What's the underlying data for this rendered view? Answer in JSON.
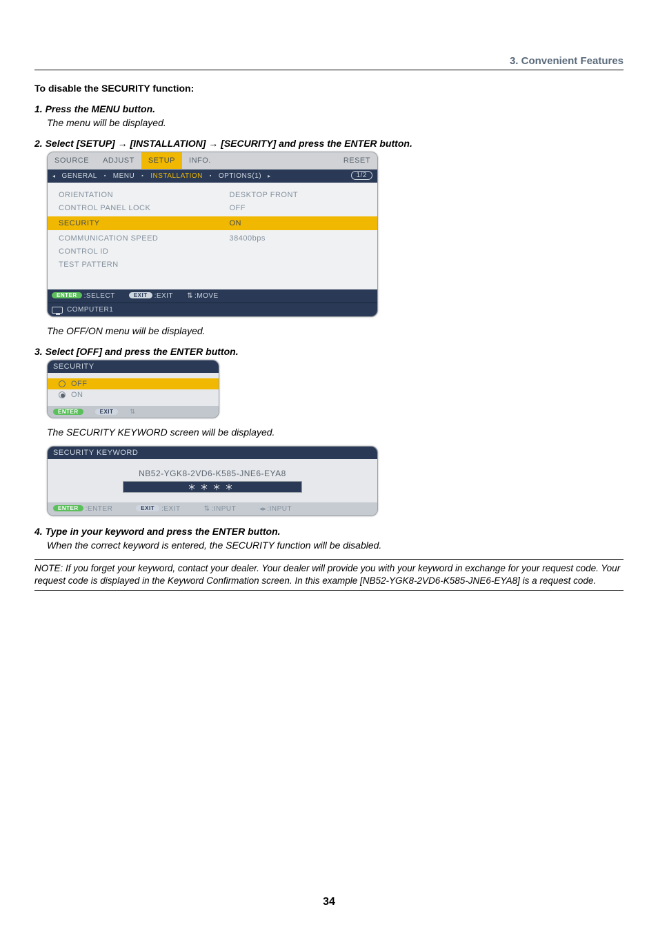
{
  "section": {
    "chapter": "3.  Convenient Features"
  },
  "headings": {
    "disable_title": "To disable the SECURITY function:"
  },
  "steps": {
    "s1": {
      "title": "1.  Press the MENU button.",
      "desc": "The menu will be displayed."
    },
    "s2": {
      "title": "2.  Select [SETUP] → [INSTALLATION] → [SECURITY] and press the ENTER button.",
      "desc_after": "The OFF/ON menu will be displayed."
    },
    "s3": {
      "title": "3.  Select [OFF] and press the ENTER button.",
      "desc_after": "The SECURITY KEYWORD screen will be displayed."
    },
    "s4": {
      "title": "4.  Type in your keyword and press the ENTER button.",
      "desc_after": "When the correct keyword is entered, the SECURITY function will be disabled."
    }
  },
  "menu1": {
    "tabs": {
      "source": "SOURCE",
      "adjust": "ADJUST",
      "setup": "SETUP",
      "info": "INFO.",
      "reset": "RESET"
    },
    "subtabs": {
      "general": "GENERAL",
      "menu": "MENU",
      "installation": "INSTALLATION",
      "options1": "OPTIONS(1)"
    },
    "page_badge": "1/2",
    "rows": {
      "orientation": {
        "label": "ORIENTATION",
        "value": "DESKTOP FRONT"
      },
      "cp_lock": {
        "label": "CONTROL PANEL LOCK",
        "value": "OFF"
      },
      "security": {
        "label": "SECURITY",
        "value": "ON"
      },
      "comm_speed": {
        "label": "COMMUNICATION SPEED",
        "value": "38400bps"
      },
      "control_id": {
        "label": "CONTROL ID",
        "value": ""
      },
      "test_pattern": {
        "label": "TEST PATTERN",
        "value": ""
      }
    },
    "footer": {
      "enter_pill": "ENTER",
      "enter_text": ":SELECT",
      "exit_pill": "EXIT",
      "exit_text": ":EXIT",
      "move_text": ":MOVE",
      "source_label": "COMPUTER1"
    }
  },
  "menu2": {
    "title": "SECURITY",
    "off": "OFF",
    "on": "ON",
    "foot": {
      "enter": "ENTER",
      "exit": "EXIT"
    }
  },
  "menu3": {
    "title": "SECURITY KEYWORD",
    "serial": "NB52-YGK8-2VD6-K585-JNE6-EYA8",
    "field": "＊＊＊＊",
    "foot": {
      "enter_pill": "ENTER",
      "enter_text": ":ENTER",
      "exit_pill": "EXIT",
      "exit_text": ":EXIT",
      "input_ud": ":INPUT",
      "input_lr": ":INPUT"
    }
  },
  "note": "NOTE: If you forget your keyword, contact your dealer. Your dealer will provide you with your keyword in exchange for your request code. Your request code is displayed in the Keyword Confirmation screen. In this example [NB52-YGK8-2VD6-K585-JNE6-EYA8] is a request code.",
  "page_number": "34"
}
